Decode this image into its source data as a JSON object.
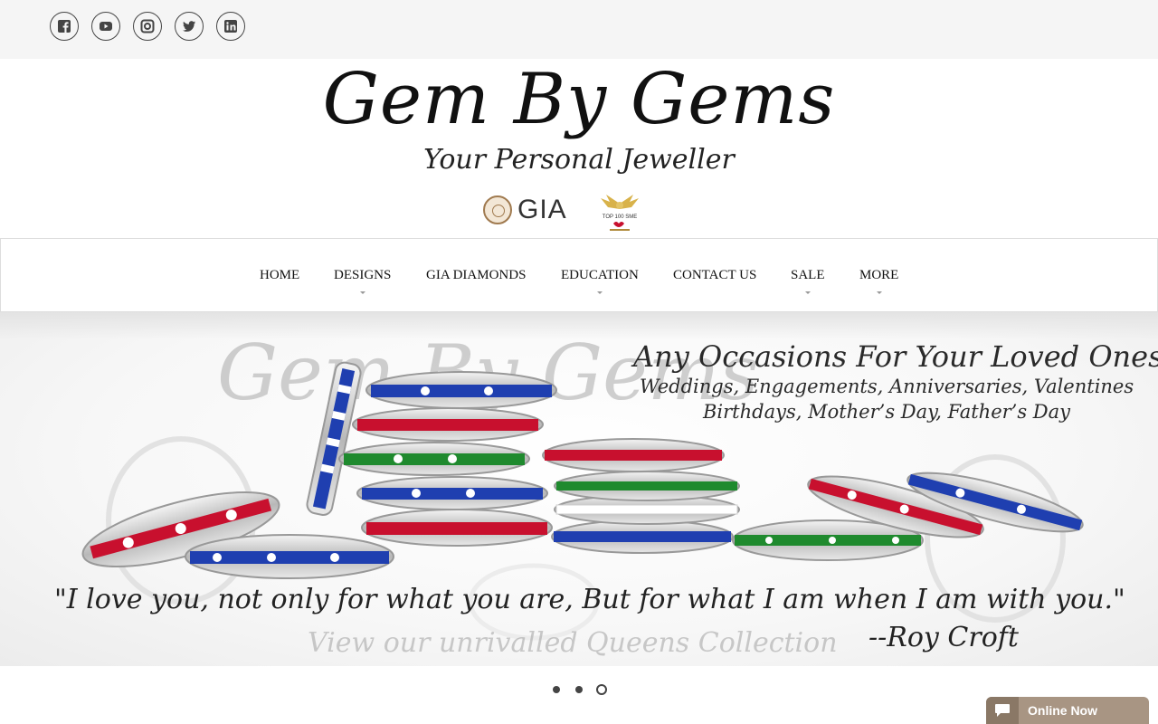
{
  "social": [
    {
      "icon": "facebook-icon"
    },
    {
      "icon": "youtube-icon"
    },
    {
      "icon": "instagram-icon"
    },
    {
      "icon": "twitter-icon"
    },
    {
      "icon": "linkedin-icon"
    }
  ],
  "logo": {
    "title": "Gem By Gems",
    "subtitle": "Your Personal Jeweller",
    "gia": "GIA",
    "sme_badge": "TOP 100 SME"
  },
  "nav": {
    "items": [
      {
        "label": "HOME",
        "has_dropdown": false
      },
      {
        "label": "DESIGNS",
        "has_dropdown": true
      },
      {
        "label": "GIA DIAMONDS",
        "has_dropdown": false
      },
      {
        "label": "EDUCATION",
        "has_dropdown": true
      },
      {
        "label": "CONTACT US",
        "has_dropdown": false
      },
      {
        "label": "SALE",
        "has_dropdown": true
      },
      {
        "label": "MORE",
        "has_dropdown": true
      }
    ]
  },
  "hero": {
    "watermark": "Gem By Gems",
    "headline": "Any Occasions For Your Loved Ones",
    "line2": "Weddings, Engagements, Anniversaries, Valentines",
    "line3": "Birthdays, Mother’s Day, Father’s Day",
    "quote": "\"I love you, not only for what you are, But for what I am when I am with you.\"",
    "author": "--Roy Croft",
    "collection": "View our unrivalled Queens Collection"
  },
  "slider": {
    "count": 3,
    "active_index": 3
  },
  "chat": {
    "label": "Online Now"
  },
  "colors": {
    "ruby": "#c8102e",
    "sapphire": "#1f3fb0",
    "emerald": "#1f8a2e",
    "chat_bg": "#a89583"
  }
}
